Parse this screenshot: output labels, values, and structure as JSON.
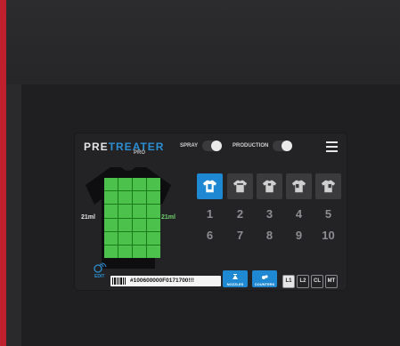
{
  "header": {
    "logo_primary": "PRE",
    "logo_secondary": "TREATER",
    "logo_sub": "PRO",
    "spray_label": "SPRAY",
    "production_label": "PRODUCTION"
  },
  "shirt": {
    "left_amount": "21ml",
    "right_amount": "21ml"
  },
  "presets": {
    "numbers": [
      "1",
      "2",
      "3",
      "4",
      "5",
      "6",
      "7",
      "8",
      "9",
      "10"
    ]
  },
  "bottom": {
    "edit_label": "EDIT",
    "barcode_text": "#100600000F0171700!!!",
    "nozzles_label": "NOZZLES",
    "counters_label": "COUNTERS",
    "channels": [
      "L1",
      "L2",
      "CL",
      "MT"
    ]
  },
  "colors": {
    "accent": "#1e88d2",
    "shirt_grid": "#4cc24c",
    "right_amount": "#6fd36f",
    "brand_red": "#c0202e"
  },
  "icons": [
    "menu-icon",
    "shirt-icon",
    "edit-icon",
    "nozzle-icon",
    "counter-icon"
  ]
}
